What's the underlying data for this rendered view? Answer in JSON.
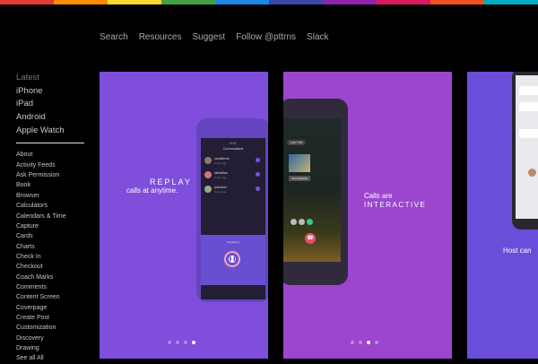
{
  "nav": [
    "Search",
    "Resources",
    "Suggest",
    "Follow @pttrns",
    "Slack"
  ],
  "primary": [
    "Latest",
    "iPhone",
    "iPad",
    "Android",
    "Apple Watch"
  ],
  "categories": [
    "About",
    "Activity Feeds",
    "Ask Permission",
    "Book",
    "Browser",
    "Calculators",
    "Calendars & Time",
    "Capture",
    "Cards",
    "Charts",
    "Check In",
    "Checkout",
    "Coach Marks",
    "Comments",
    "Content Screen",
    "Coverpage",
    "Create Post",
    "Customization",
    "Discovery",
    "Drawing",
    "See all All"
  ],
  "cards": [
    {
      "headline_a": "REPLAY",
      "headline_b": "calls at anytime.",
      "bg": "#7f4fdb"
    },
    {
      "headline_a": "Calls are",
      "headline_b": "INTERACTIVE",
      "bg": "#9c46cf"
    },
    {
      "headline_a": "Host can",
      "bg": "#6a4dd8"
    }
  ],
  "carousel": {
    "count": 4,
    "card1_active": 3,
    "card2_active": 2
  },
  "rainbow": [
    "#e53935",
    "#fb8c00",
    "#fdd835",
    "#43a047",
    "#1e88e5",
    "#3949ab",
    "#8e24aa",
    "#d81b60",
    "#f4511e",
    "#00acc1"
  ]
}
